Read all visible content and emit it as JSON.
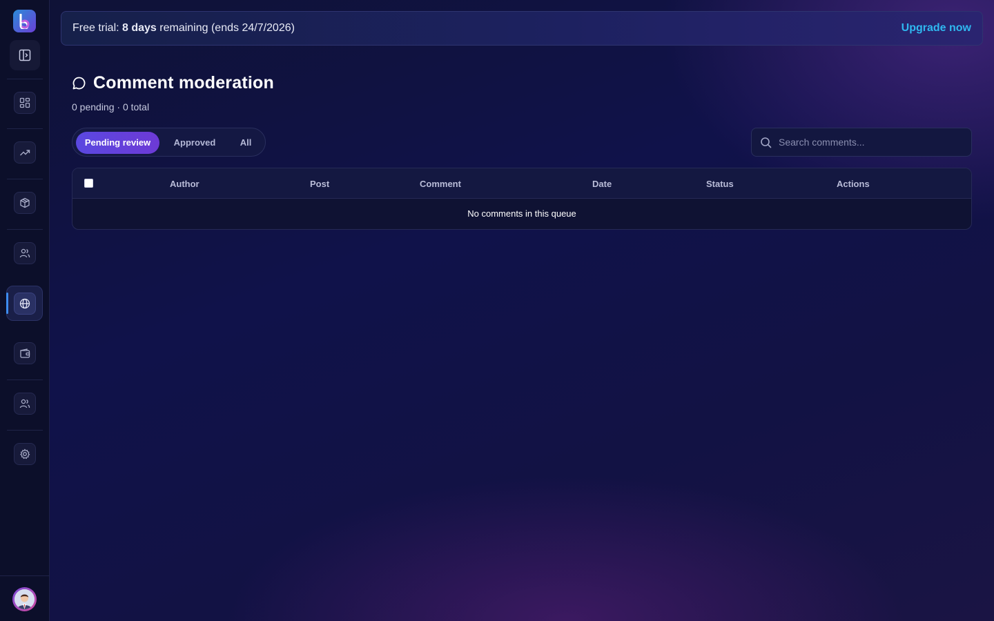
{
  "banner": {
    "prefix": "Free trial: ",
    "days": "8 days",
    "suffix": " remaining (ends 24/7/2026)",
    "upgrade_label": "Upgrade now"
  },
  "header": {
    "title": "Comment moderation",
    "subtitle": "0 pending · 0 total"
  },
  "tabs": [
    {
      "label": "Pending review",
      "active": true
    },
    {
      "label": "Approved",
      "active": false
    },
    {
      "label": "All",
      "active": false
    }
  ],
  "search": {
    "placeholder": "Search comments..."
  },
  "table": {
    "columns": [
      "Author",
      "Post",
      "Comment",
      "Date",
      "Status",
      "Actions"
    ],
    "rows": [],
    "empty_message": "No comments in this queue"
  },
  "sidebar": {
    "items": [
      {
        "icon": "dashboard-icon"
      },
      {
        "icon": "trending-icon"
      },
      {
        "icon": "package-icon"
      },
      {
        "icon": "users-icon"
      },
      {
        "icon": "globe-icon",
        "active": true
      },
      {
        "icon": "wallet-icon"
      },
      {
        "icon": "team-icon"
      },
      {
        "icon": "settings-icon"
      }
    ]
  },
  "colors": {
    "accent": "#5a48e0",
    "link": "#2fb8f0",
    "active_indicator": "#3d8cf0"
  }
}
